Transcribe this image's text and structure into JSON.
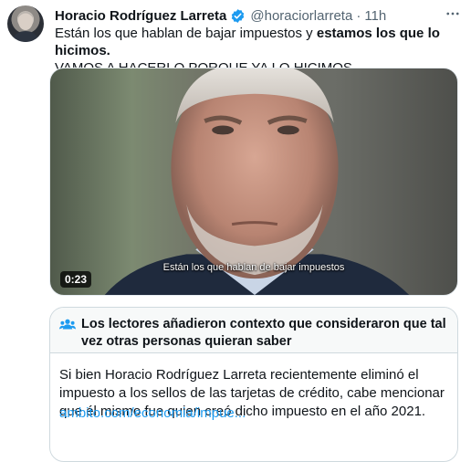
{
  "tweet": {
    "display_name": "Horacio Rodríguez Larreta",
    "handle": "@horaciorlarreta",
    "separator": "·",
    "time": "11h",
    "more_icon": "more-horizontal-icon",
    "text_part1": "Están los que hablan de bajar impuestos y ",
    "text_bold": "estamos los que lo hicimos.",
    "text_part2": "VAMOS A HACERLO PORQUE YA LO HICIMOS."
  },
  "video": {
    "duration": "0:23",
    "subtitle": "Están los que hablan de bajar impuestos"
  },
  "community_note": {
    "icon": "people-icon",
    "title": "Los lectores añadieron contexto que consideraron que tal vez otras personas quieran saber",
    "body": "Si bien Horacio Rodríguez Larreta recientemente eliminó el impuesto a los sellos de las tarjetas de crédito, cabe mencionar que él mismo fue quien creó dicho impuesto en el año 2021.",
    "link": "ambito.com/economia/impue..."
  },
  "colors": {
    "accent": "#1d9bf0",
    "verified": "#1d9bf0",
    "secondary_text": "#536471",
    "note_header_bg": "#f7f9f9"
  }
}
